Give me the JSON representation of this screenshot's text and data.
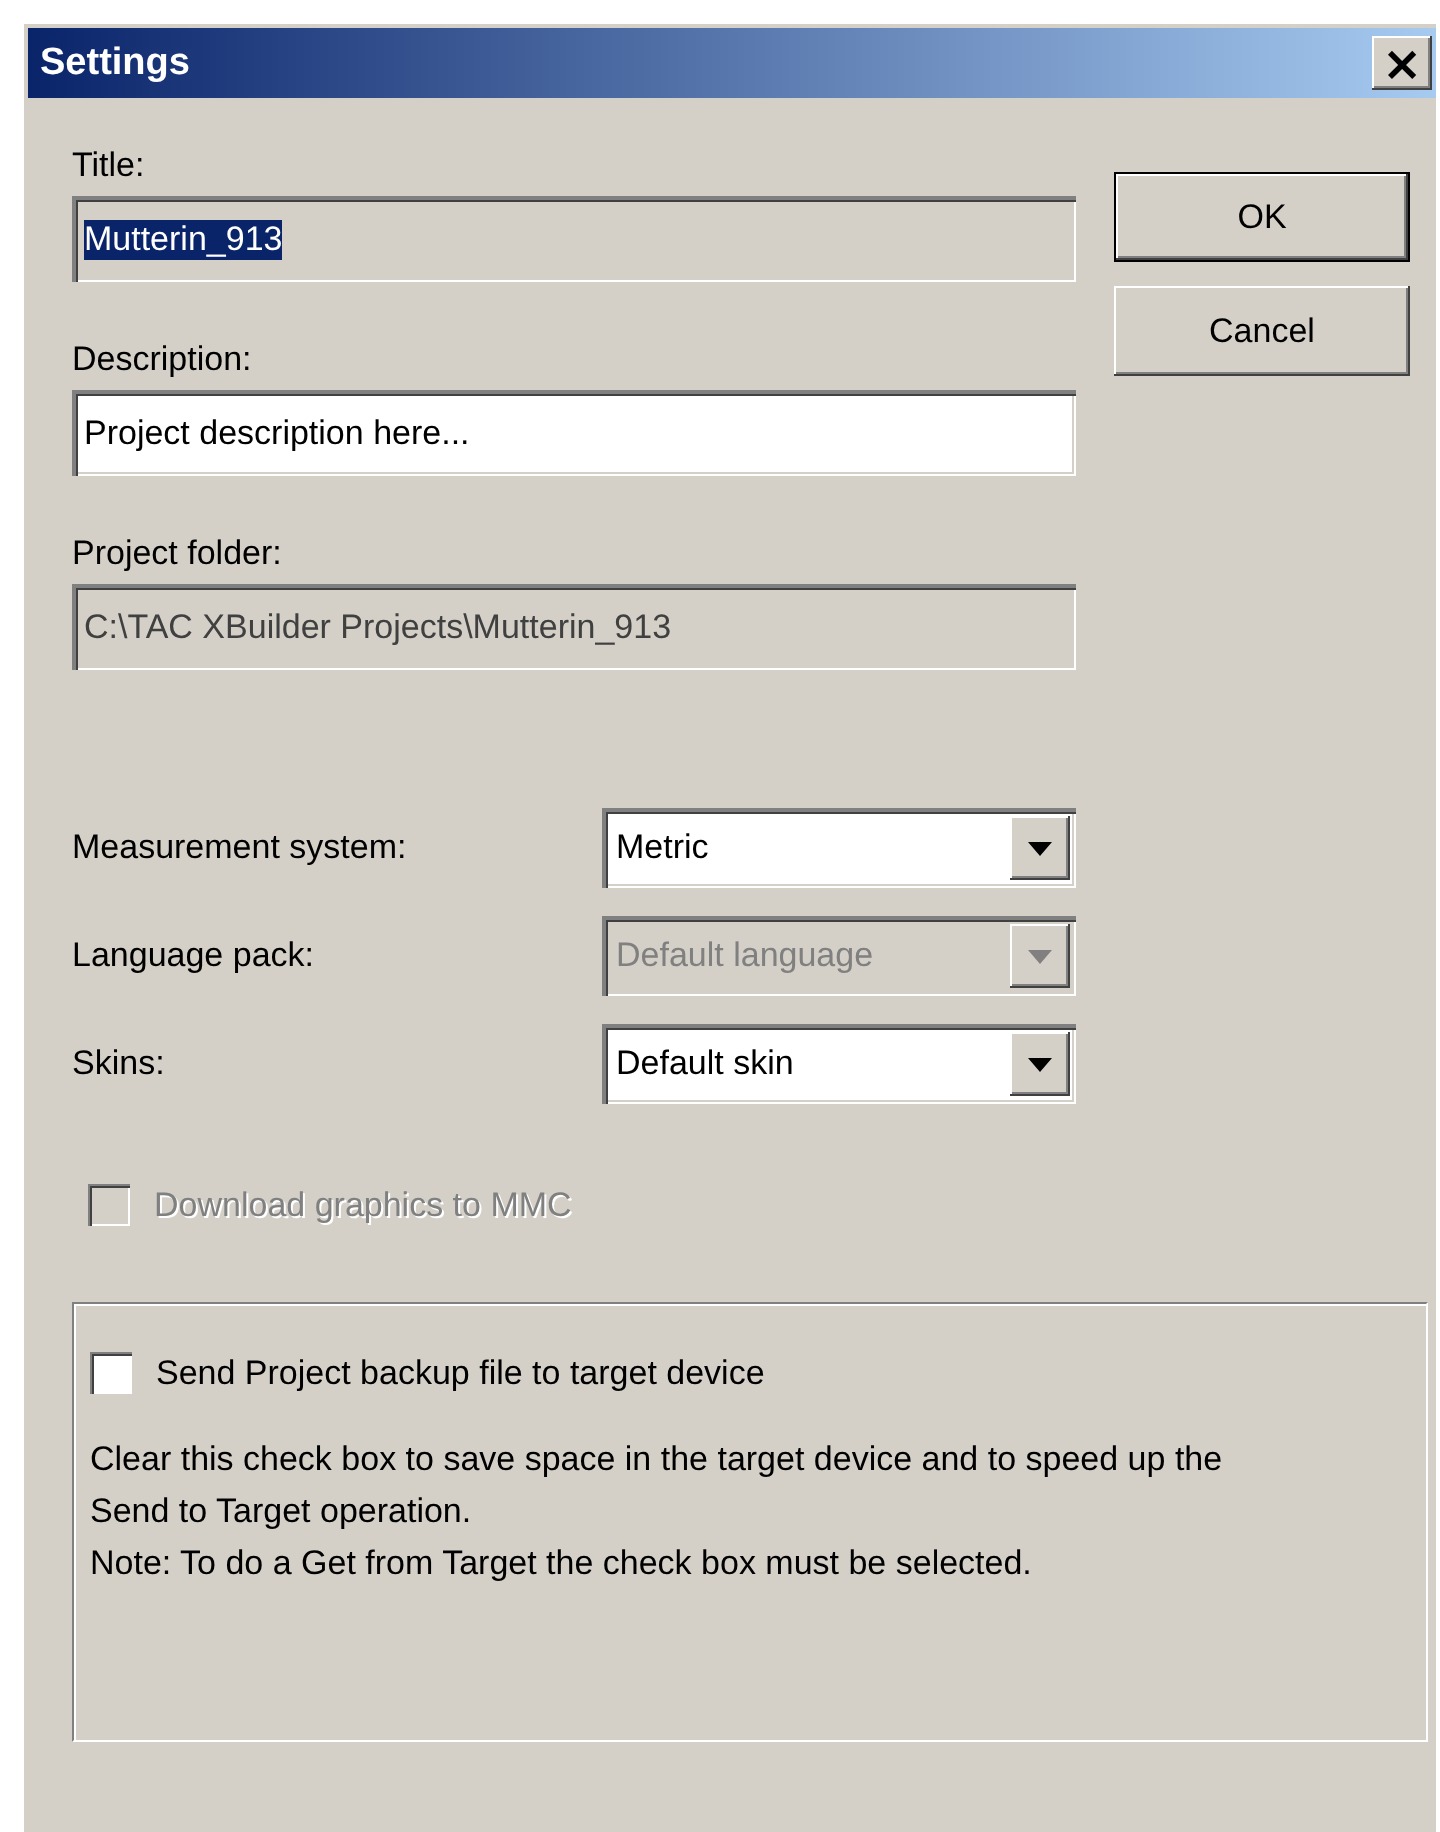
{
  "window": {
    "title": "Settings",
    "close_glyph": "×"
  },
  "buttons": [
    {
      "label": "OK",
      "default": true
    },
    {
      "label": "Cancel",
      "default": false
    }
  ],
  "fields": [
    {
      "label": "Title:",
      "value": "Mutterin_913",
      "readonly": true,
      "selected": true
    },
    {
      "label": "Description:",
      "value": "Project description here...",
      "readonly": false,
      "selected": false
    },
    {
      "label": "Project folder:",
      "value": "C:\\TAC XBuilder Projects\\Mutterin_913",
      "readonly": true,
      "selected": false
    }
  ],
  "combos": [
    {
      "label": "Measurement system:",
      "value": "Metric",
      "disabled": false
    },
    {
      "label": "Language pack:",
      "value": "Default language",
      "disabled": true
    },
    {
      "label": "Skins:",
      "value": "Default skin",
      "disabled": false
    }
  ],
  "download_checkbox": {
    "label": "Download graphics to MMC",
    "checked": false,
    "disabled": true
  },
  "backup_group": {
    "checkbox": {
      "label": "Send Project backup file to target device",
      "checked": false,
      "disabled": false
    },
    "note_lines": [
      "Clear this check box to save space in the target device and to speed up the Send to Target operation.",
      "Note: To do a Get from Target the check box must be selected."
    ]
  }
}
